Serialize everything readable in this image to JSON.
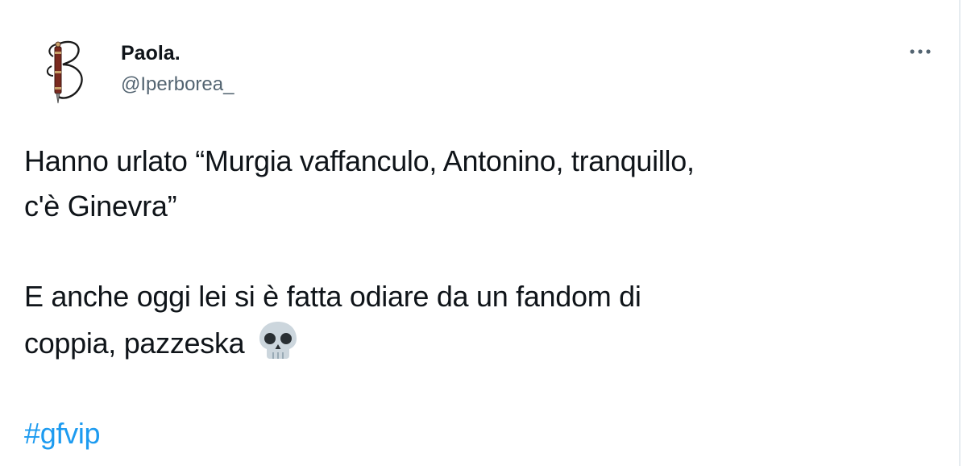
{
  "author": {
    "display_name": "Paola.",
    "handle": "@Iperborea_",
    "avatar_icon": "letter-b-logo-icon"
  },
  "actions": {
    "more_icon": "more-dots-icon"
  },
  "tweet": {
    "line1": "Hanno urlato “Murgia vaffanculo, Antonino, tranquillo,",
    "line2": "c'è Ginevra”",
    "line3": "E anche oggi lei si è fatta odiare da un fandom di",
    "line4": "coppia, pazzeska",
    "emoji_icon": "skull-emoji-icon",
    "hashtag": "#gfvip"
  },
  "colors": {
    "text": "#0f1419",
    "secondary": "#536471",
    "link": "#1d9bf0"
  }
}
